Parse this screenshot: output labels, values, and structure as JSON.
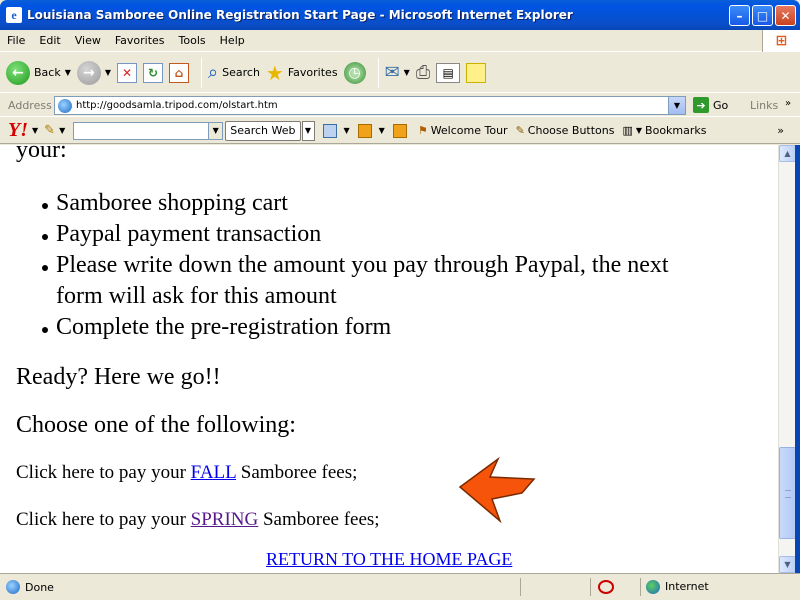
{
  "window": {
    "title": "Louisiana Samboree Online Registration Start Page - Microsoft Internet Explorer",
    "app_icon": "ie-icon",
    "controls": [
      "minimize",
      "maximize",
      "close"
    ]
  },
  "menubar": {
    "items": [
      "File",
      "Edit",
      "View",
      "Favorites",
      "Tools",
      "Help"
    ]
  },
  "toolbar": {
    "back_label": "Back",
    "search_label": "Search",
    "favorites_label": "Favorites"
  },
  "addressbar": {
    "label": "Address",
    "url": "http://goodsamla.tripod.com/olstart.htm",
    "go_label": "Go",
    "links_label": "Links",
    "more": "»"
  },
  "yahoobar": {
    "logo": "Y!",
    "search_input": "",
    "search_button": "Search Web",
    "welcome_tour": "Welcome Tour",
    "choose_buttons": "Choose Buttons",
    "bookmarks": "Bookmarks",
    "more": "»"
  },
  "content": {
    "lead": "your:",
    "steps": [
      "Samboree shopping cart",
      "Paypal payment transaction",
      "Please write down the amount you pay through Paypal, the next form will ask for this amount",
      "Complete the pre-registration form"
    ],
    "ready": "Ready? Here we go!!",
    "choose": "Choose one of the following:",
    "fall_prefix": "Click here to pay your ",
    "fall_link": "FALL",
    "fall_suffix": " Samboree fees;",
    "spring_prefix": "Click here to pay your ",
    "spring_link": "SPRING",
    "spring_suffix": " Samboree fees;",
    "home_link": "RETURN TO THE HOME PAGE",
    "arrow_color": "#f5540a"
  },
  "statusbar": {
    "status": "Done",
    "zone": "Internet"
  }
}
